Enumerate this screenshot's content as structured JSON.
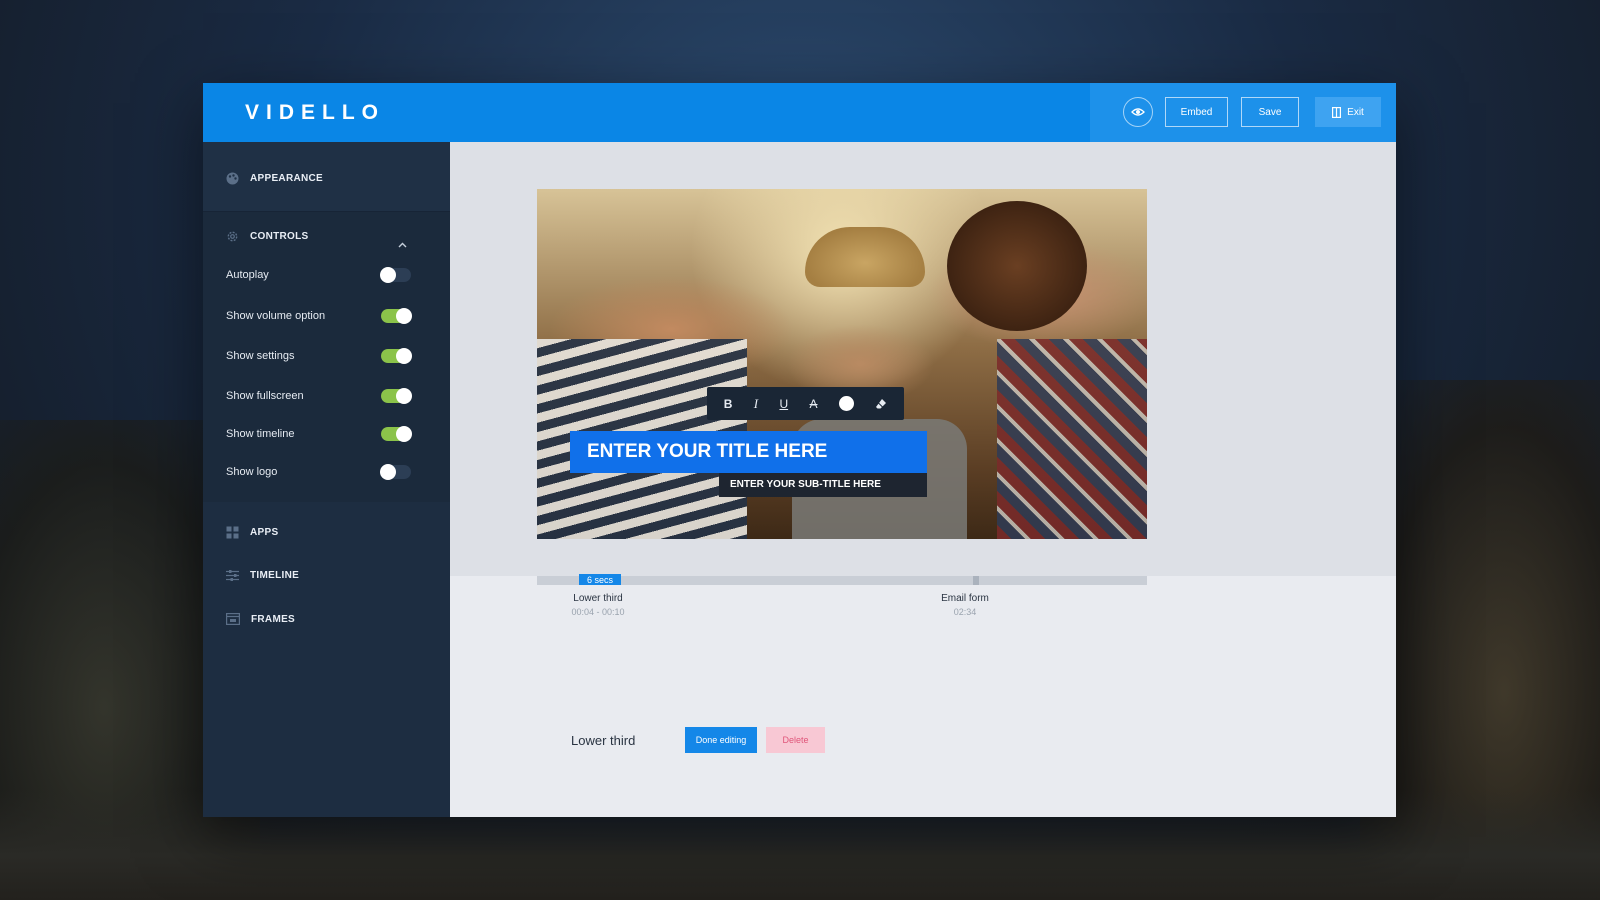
{
  "header": {
    "logo": "VIDELLO",
    "embed_label": "Embed",
    "save_label": "Save",
    "exit_label": "Exit"
  },
  "sidebar": {
    "appearance_label": "APPEARANCE",
    "controls_label": "CONTROLS",
    "controls": [
      {
        "label": "Autoplay",
        "on": false
      },
      {
        "label": "Show volume option",
        "on": true
      },
      {
        "label": "Show settings",
        "on": true
      },
      {
        "label": "Show fullscreen",
        "on": true
      },
      {
        "label": "Show timeline",
        "on": true
      },
      {
        "label": "Show logo",
        "on": false
      }
    ],
    "apps_label": "APPS",
    "timeline_label": "TIMELINE",
    "frames_label": "FRAMES"
  },
  "video": {
    "format_bar": {
      "bold": "B",
      "italic": "I",
      "underline": "U",
      "strike": "A"
    },
    "title_text": "ENTER YOUR TITLE HERE",
    "subtitle_text": "ENTER YOUR SUB-TITLE HERE"
  },
  "timeline": {
    "segment_label": "6 secs",
    "items": [
      {
        "name": "Lower third",
        "time": "00:04 - 00:10"
      },
      {
        "name": "Email form",
        "time": "02:34"
      }
    ]
  },
  "editor": {
    "title": "Lower third",
    "done_label": "Done editing",
    "delete_label": "Delete"
  },
  "colors": {
    "header_blue": "#0a86e6",
    "sidebar_navy": "#1c2b3e",
    "toggle_on": "#8bc34a",
    "title_blue": "#1070ea",
    "delete_pink": "#f8c8d4"
  }
}
